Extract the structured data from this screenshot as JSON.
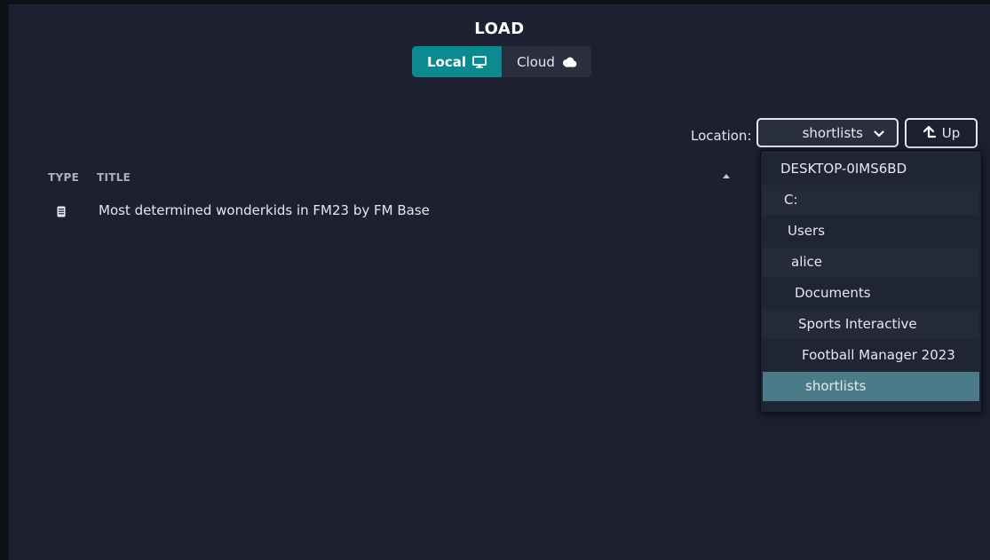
{
  "dialog": {
    "title": "LOAD"
  },
  "source_toggle": {
    "local_label": "Local",
    "local_icon": "monitor-icon",
    "cloud_label": "Cloud",
    "cloud_icon": "cloud-icon",
    "active": "Local",
    "active_color": "#0b8a8f"
  },
  "location": {
    "label": "Location:",
    "selected": "shortlists",
    "up_label": "Up",
    "options": [
      "DESKTOP-0IMS6BD",
      "C:",
      "Users",
      "alice",
      "Documents",
      "Sports Interactive",
      "Football Manager 2023",
      "shortlists"
    ],
    "selected_color": "#4b7a88"
  },
  "table": {
    "columns": [
      "TYPE",
      "TITLE"
    ],
    "rows": [
      {
        "type_icon": "document-icon",
        "title": "Most determined wonderkids in FM23 by FM Base"
      }
    ]
  }
}
